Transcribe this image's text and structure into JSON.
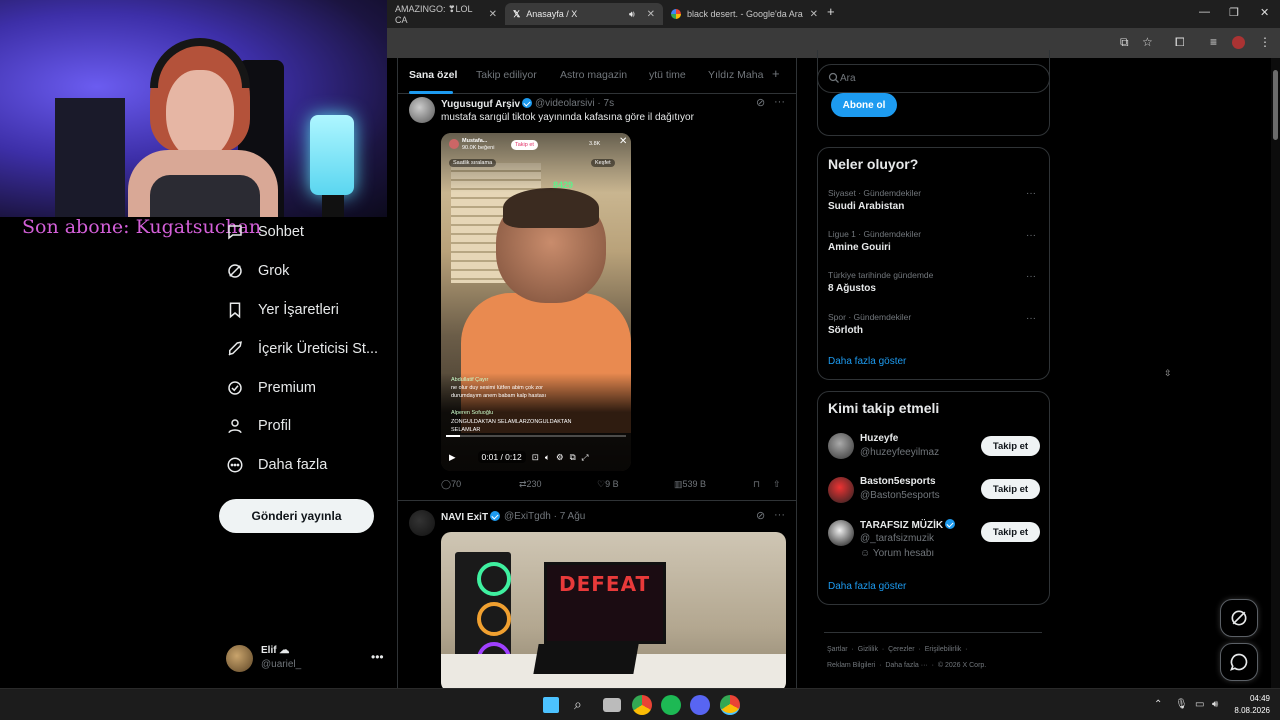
{
  "browser": {
    "tabs": [
      {
        "title": "AMAZINGO: ❣LOL CA",
        "active": false
      },
      {
        "title": "Anasayfa / X",
        "active": true
      },
      {
        "title": "black desert. - Google'da Ara",
        "active": false
      }
    ],
    "new_tab": "+"
  },
  "stream_overlay": {
    "last_sub": "Son abone: Kugatsuchan"
  },
  "nav": {
    "items": [
      {
        "label": "Sohbet",
        "icon": "chat-icon"
      },
      {
        "label": "Grok",
        "icon": "grok-icon"
      },
      {
        "label": "Yer İşaretleri",
        "icon": "bookmark-icon"
      },
      {
        "label": "İçerik Üreticisi St...",
        "icon": "rocket-icon"
      },
      {
        "label": "Premium",
        "icon": "verified-icon"
      },
      {
        "label": "Profil",
        "icon": "person-icon"
      },
      {
        "label": "Daha fazla",
        "icon": "more-circle-icon"
      }
    ],
    "post_button": "Gönderi yayınla"
  },
  "account": {
    "name": "Elif ☁",
    "handle": "@uariel_"
  },
  "feed": {
    "tabs": [
      "Sana özel",
      "Takip ediliyor",
      "Astro magazin",
      "ytü time",
      "Yıldız Maha"
    ],
    "tweets": [
      {
        "name": "Yugusuguf Arşiv",
        "handle": "@videolarsivi",
        "time": "· 7s",
        "text": "mustafa sarıgül tiktok yayınında kafasına göre il dağıtıyor",
        "video": {
          "streamer": "Mustafa...",
          "likes": "90.0K beğeni",
          "follow": "Takip et",
          "viewers": "3.8K",
          "tag1": "Saatlik sıralama",
          "tag2": "Keşfet",
          "counter": "8429",
          "comments": [
            "Abdullatif Çayır",
            "ne olur duy sesimi lütfen abim çok zor",
            "durumdayım anem babam kalp hastası",
            "Alperen Sofuoğlu",
            "ZONGULDAKTAN SELAMLARZONGULDAKTAN",
            "SELAMLAR"
          ],
          "time": "0:01 / 0:12"
        },
        "stats": {
          "replies": "70",
          "reposts": "230",
          "likes": "9 B",
          "views": "539 B"
        }
      },
      {
        "name": "NAVI ExiT",
        "handle": "@ExiTgdh",
        "time": "· 7 Ağu",
        "photo_text": "DEFEAT"
      }
    ]
  },
  "right": {
    "search_placeholder": "Ara",
    "subscribe": "Abone ol",
    "trends_title": "Neler oluyor?",
    "trends": [
      {
        "category": "Siyaset · Gündemdekiler",
        "title": "Suudi Arabistan"
      },
      {
        "category": "Ligue 1 · Gündemdekiler",
        "title": "Amine Gouiri"
      },
      {
        "category": "Türkiye tarihinde gündemde",
        "title": "8 Ağustos"
      },
      {
        "category": "Spor · Gündemdekiler",
        "title": "Sörloth"
      }
    ],
    "show_more": "Daha fazla göster",
    "who_to_follow_title": "Kimi takip etmeli",
    "who_to_follow": [
      {
        "name": "Huzeyfe",
        "handle": "@huzeyfeeyilmaz",
        "button": "Takip et"
      },
      {
        "name": "Baston5esports",
        "handle": "@Baston5esports",
        "button": "Takip et"
      },
      {
        "name": "TARAFSIZ MÜZİK",
        "handle": "@_tarafsizmuzik",
        "note": "Yorum hesabı",
        "button": "Takip et"
      }
    ],
    "footer": {
      "row1": [
        "Şartlar",
        "Gizlilik",
        "Çerezler",
        "Erişilebilirlik"
      ],
      "row2": [
        "Reklam Bilgileri",
        "Daha fazla",
        "© 2026 X Corp."
      ]
    }
  },
  "taskbar": {
    "time": "04:49",
    "date": "8.08.2026"
  },
  "colors": {
    "accent": "#1d9bf0",
    "overlay_text": "#d35fd8",
    "bg": "#000000"
  }
}
